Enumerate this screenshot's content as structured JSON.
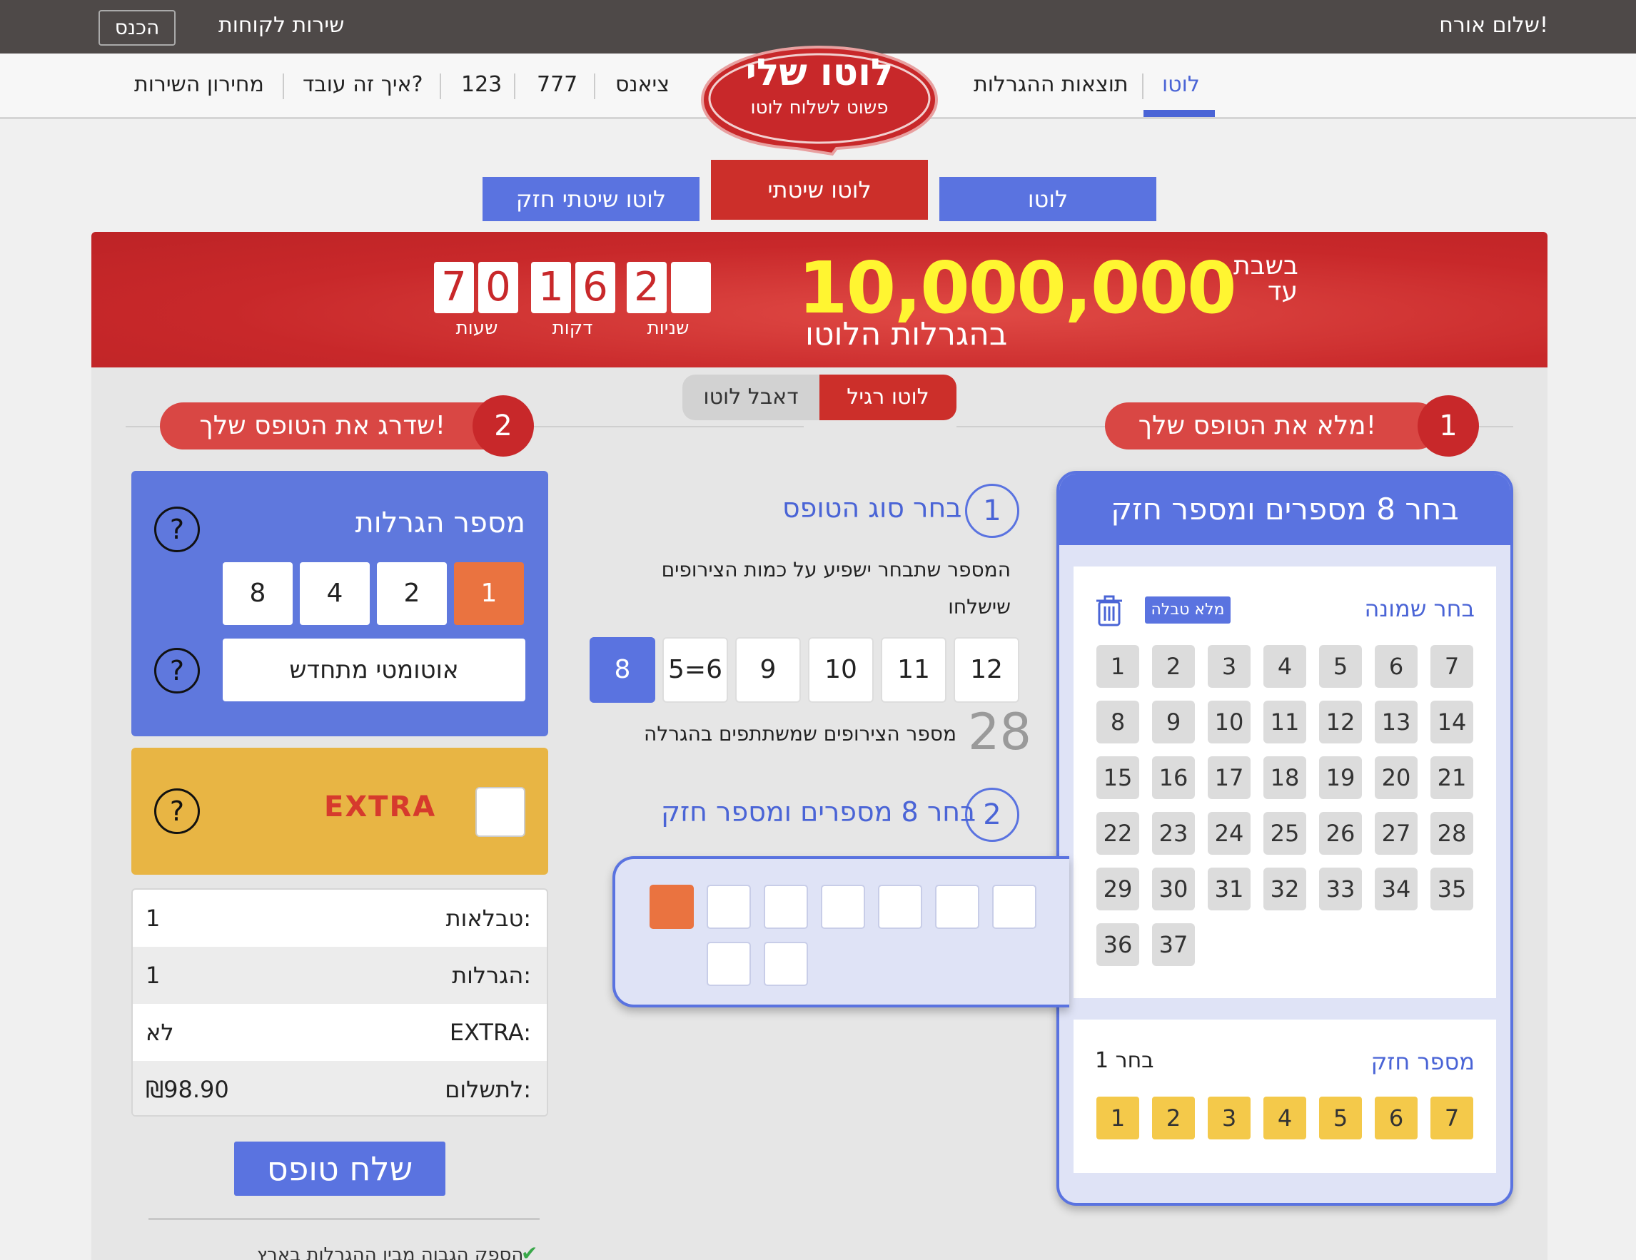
{
  "topbar": {
    "greeting": "שלום אורח!",
    "customer_service": "שירות לקוחות",
    "login": "הכנס"
  },
  "nav": {
    "items": [
      "לוטו",
      "תוצאות ההגרלות",
      "ציאנס",
      "777",
      "123",
      "איך זה עובד?",
      "מחירון השירות"
    ],
    "active_index": 0
  },
  "logo": {
    "title": "לוטו שלי",
    "tagline": "פשוט לשלוח לוטו"
  },
  "product_tabs": [
    "לוטו",
    "לוטו שיטתי",
    "לוטו שיטתי חזק"
  ],
  "banner": {
    "prefix": "בשבת עד",
    "amount": "10,000,000",
    "subtitle": "בהגרלות הלוטו",
    "hours": [
      "7",
      "0"
    ],
    "minutes": [
      "1",
      "6"
    ],
    "seconds": [
      "2",
      ""
    ],
    "label_hours": "שעות",
    "label_minutes": "דקות",
    "label_seconds": "שניות"
  },
  "toggle": {
    "regular": "לוטו רגיל",
    "double": "דאבל לוטו"
  },
  "section1": {
    "num": "1",
    "title": "מלא את הטופס שלך!"
  },
  "section2": {
    "num": "2",
    "title": "שדרג את הטופס שלך!"
  },
  "pick_card": {
    "header": "בחר 8 מספרים ומספר חזק",
    "choose_eight": "בחר שמונה",
    "fill_table": "מלא טבלה",
    "numbers": [
      "1",
      "2",
      "3",
      "4",
      "5",
      "6",
      "7",
      "8",
      "9",
      "10",
      "11",
      "12",
      "13",
      "14",
      "15",
      "16",
      "17",
      "18",
      "19",
      "20",
      "21",
      "22",
      "23",
      "24",
      "25",
      "26",
      "27",
      "28",
      "29",
      "30",
      "31",
      "32",
      "33",
      "34",
      "35",
      "36",
      "37"
    ],
    "strong_title": "מספר חזק",
    "strong_hint": "בחר 1",
    "strong_numbers": [
      "1",
      "2",
      "3",
      "4",
      "5",
      "6",
      "7"
    ]
  },
  "middle": {
    "step1_num": "1",
    "step1_title": "בחר סוג הטופס",
    "step1_desc1": "המספר שתבחר ישפיע על כמות הצירופים",
    "step1_desc2": "שישלחו",
    "form_types": [
      "12",
      "11",
      "10",
      "9",
      "5=6",
      "8"
    ],
    "selected_form": "8",
    "combos_count": "28",
    "combos_text": "מספר הצירופים שמשתתפים בהגרלה",
    "step2_num": "2",
    "step2_title": "בחר 8 מספרים ומספר חזק"
  },
  "draws": {
    "title": "מספר הגרלות",
    "options": [
      "1",
      "2",
      "4",
      "8"
    ],
    "selected": "1",
    "auto_renew": "אוטומטי מתחדש",
    "help": "?"
  },
  "extra": {
    "logo_text": "EXTRA",
    "help": "?"
  },
  "summary": [
    {
      "key": "טבלאות:",
      "value": "1"
    },
    {
      "key": "הגרלות:",
      "value": "1"
    },
    {
      "key": "EXTRA:",
      "value": "לא"
    },
    {
      "key": "לתשלום:",
      "value": "₪98.90"
    }
  ],
  "send_button": "שלח טופס",
  "footer_note": "הספק הגבוה מבין ההגרלות בארץ",
  "colors": {
    "red": "#cc2f2a",
    "blue": "#5a73e0",
    "orange": "#ea7340",
    "yellow": "#f4c94a",
    "gold_card": "#e8b544"
  }
}
